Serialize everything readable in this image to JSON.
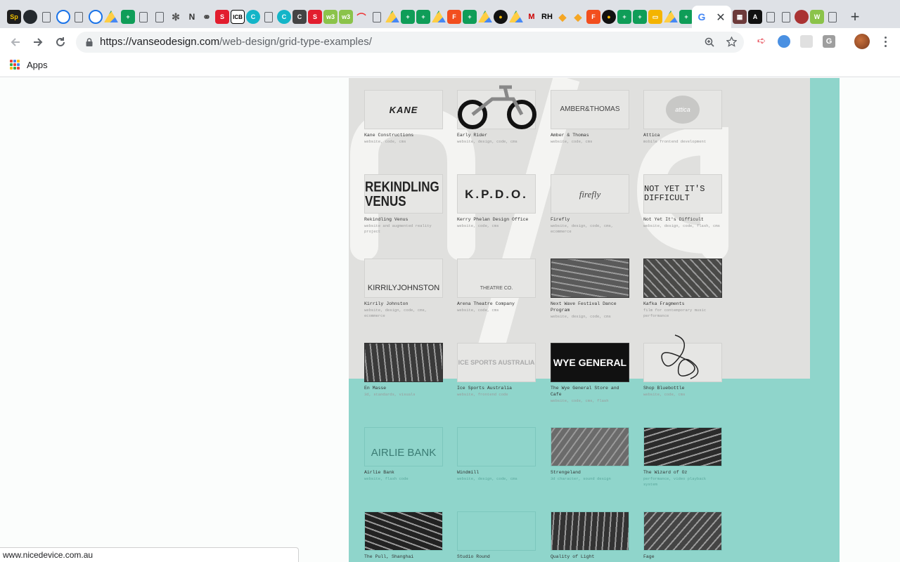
{
  "browser": {
    "url_host": "https://vanseodesign.com",
    "url_path": "/web-design/grid-type-examples/",
    "bookmarks_label": "Apps",
    "tab_labels": [
      "Sp",
      "ICB",
      "C",
      "C",
      "S",
      "RH",
      "F",
      "G",
      "W"
    ],
    "status_url": "www.nicedevice.com.au"
  },
  "portfolio": [
    {
      "title": "Kane Constructions",
      "sub": "website, code, cms",
      "logo": "KANE"
    },
    {
      "title": "Early Rider",
      "sub": "website, design, code, cms",
      "logo": ""
    },
    {
      "title": "Amber & Thomas",
      "sub": "website, code, cms",
      "logo": "AMBER&THOMAS"
    },
    {
      "title": "Attica",
      "sub": "mobile frontend development",
      "logo": "attica"
    },
    {
      "title": "Rekindling Venus",
      "sub": "website and augmented reality project",
      "logo": "REKINDLING VENUS"
    },
    {
      "title": "Kerry Phelan Design Office",
      "sub": "website, code, cms",
      "logo": "K.P.D.O."
    },
    {
      "title": "Firefly",
      "sub": "website, design, code, cms, ecommerce",
      "logo": "firefly"
    },
    {
      "title": "Not Yet It's Difficult",
      "sub": "website, design, code, flash, cms",
      "logo": "NOT YET IT'S DIFFICULT"
    },
    {
      "title": "Kirrily Johnston",
      "sub": "website, design, code, cms, ecommerce",
      "logo": "KIRRILYJOHNSTON"
    },
    {
      "title": "Arena Theatre Company",
      "sub": "website, code, cms",
      "logo": "THEATRE CO."
    },
    {
      "title": "Next Wave Festival Dance Program",
      "sub": "website, design, code, cms",
      "logo": ""
    },
    {
      "title": "Kafka Fragments",
      "sub": "film for contemporary music performance",
      "logo": ""
    },
    {
      "title": "En Masse",
      "sub": "3d, standards, visuals",
      "logo": ""
    },
    {
      "title": "Ice Sports Australia",
      "sub": "website, frontend code",
      "logo": "ICE SPORTS AUSTRALIA"
    },
    {
      "title": "The Wye General Store and Cafe",
      "sub": "website, code, cms, flash",
      "logo": "WYE GENERAL"
    },
    {
      "title": "Shop Bluebottle",
      "sub": "website, code, cms",
      "logo": ""
    },
    {
      "title": "Airlie Bank",
      "sub": "website, flash code",
      "logo": "AIRLIE BANK"
    },
    {
      "title": "Windmill",
      "sub": "website, design, code, cms",
      "logo": ""
    },
    {
      "title": "Strengeland",
      "sub": "3d character, sound design",
      "logo": ""
    },
    {
      "title": "The Wizard of Oz",
      "sub": "performance, video playback system",
      "logo": ""
    },
    {
      "title": "The Pull, Shanghai",
      "sub": "",
      "logo": ""
    },
    {
      "title": "Studio Round",
      "sub": "",
      "logo": ""
    },
    {
      "title": "Quality of Light",
      "sub": "",
      "logo": ""
    },
    {
      "title": "Fage",
      "sub": "",
      "logo": ""
    }
  ]
}
